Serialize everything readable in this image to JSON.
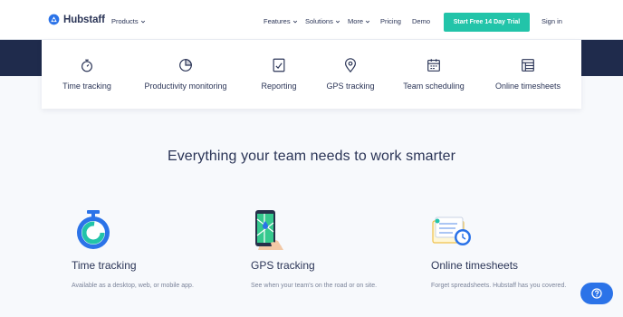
{
  "header": {
    "logo_text": "Hubstaff",
    "products_label": "Products",
    "nav": [
      {
        "label": "Features",
        "dropdown": true
      },
      {
        "label": "Solutions",
        "dropdown": true
      },
      {
        "label": "More",
        "dropdown": true
      },
      {
        "label": "Pricing",
        "dropdown": false
      },
      {
        "label": "Demo",
        "dropdown": false
      }
    ],
    "cta_label": "Start Free 14 Day Trial",
    "signin_label": "Sign in"
  },
  "products": [
    {
      "label": "Time tracking",
      "icon": "stopwatch-icon"
    },
    {
      "label": "Productivity monitoring",
      "icon": "gauge-icon"
    },
    {
      "label": "Reporting",
      "icon": "report-icon"
    },
    {
      "label": "GPS tracking",
      "icon": "map-pin-icon"
    },
    {
      "label": "Team scheduling",
      "icon": "calendar-icon"
    },
    {
      "label": "Online timesheets",
      "icon": "timesheet-icon"
    }
  ],
  "headline": "Everything your team needs to work smarter",
  "features": [
    {
      "title": "Time tracking",
      "desc": "Available as a desktop, web, or mobile app.",
      "icon": "stopwatch-illustration"
    },
    {
      "title": "GPS tracking",
      "desc": "See when your team's on the road or on site.",
      "icon": "phone-map-illustration"
    },
    {
      "title": "Online timesheets",
      "desc": "Forget spreadsheets. Hubstaff has you covered.",
      "icon": "timesheet-illustration"
    }
  ],
  "colors": {
    "brand_navy": "#1f2b4c",
    "cta_green": "#22c4a9",
    "help_blue": "#2b73e8"
  },
  "help_icon": "help-icon"
}
